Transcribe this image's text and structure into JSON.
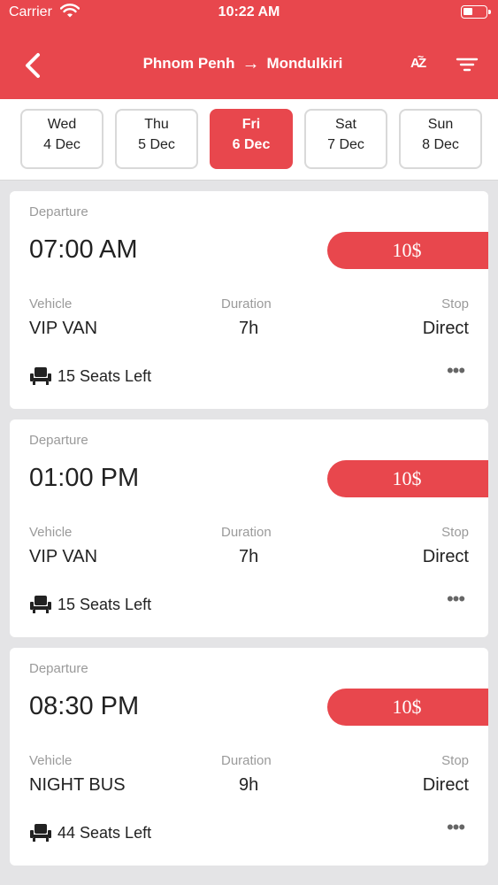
{
  "status_bar": {
    "carrier": "Carrier",
    "time": "10:22 AM"
  },
  "header": {
    "origin": "Phnom Penh",
    "destination": "Mondulkiri",
    "arrow": "→",
    "sort_letter_a": "A",
    "sort_letter_z": "Z",
    "sort_tilde": "~",
    "icons": {
      "back": "chevron-left-icon",
      "sort": "sort-az-icon",
      "filter": "filter-icon"
    }
  },
  "dates": [
    {
      "day": "Wed",
      "date": "4 Dec",
      "selected": false
    },
    {
      "day": "Thu",
      "date": "5 Dec",
      "selected": false
    },
    {
      "day": "Fri",
      "date": "6 Dec",
      "selected": true
    },
    {
      "day": "Sat",
      "date": "7 Dec",
      "selected": false
    },
    {
      "day": "Sun",
      "date": "8 Dec",
      "selected": false
    }
  ],
  "labels": {
    "departure": "Departure",
    "vehicle": "Vehicle",
    "duration": "Duration",
    "stop": "Stop"
  },
  "trips": [
    {
      "time": "07:00 AM",
      "price": "10$",
      "vehicle": "VIP VAN",
      "duration": "7h",
      "stop": "Direct",
      "seats": "15 Seats Left",
      "more": "•••"
    },
    {
      "time": "01:00 PM",
      "price": "10$",
      "vehicle": "VIP VAN",
      "duration": "7h",
      "stop": "Direct",
      "seats": "15 Seats Left",
      "more": "•••"
    },
    {
      "time": "08:30 PM",
      "price": "10$",
      "vehicle": "NIGHT BUS",
      "duration": "9h",
      "stop": "Direct",
      "seats": "44 Seats Left",
      "more": "•••"
    }
  ],
  "colors": {
    "accent": "#e8474d",
    "background": "#e4e4e6",
    "card": "#ffffff",
    "muted": "#9a9a9a"
  }
}
